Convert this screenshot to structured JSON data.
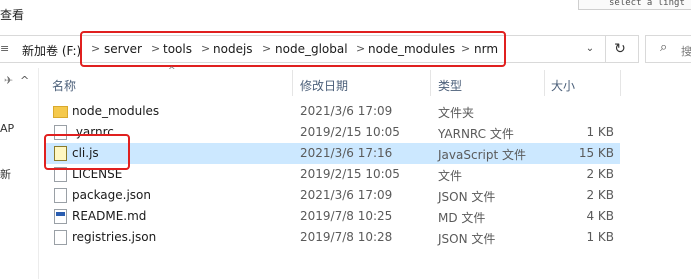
{
  "ribbon": {
    "tab_label": "查看",
    "tooltip_text": "select a lingt"
  },
  "address": {
    "drive_icon_char": "≡",
    "crumbs": [
      "新加卷 (F:)",
      "server",
      "tools",
      "nodejs",
      "node_global",
      "node_modules",
      "nrm"
    ],
    "separator": ">",
    "dropdown_char": "⌄",
    "refresh_char": "↻"
  },
  "search": {
    "icon_char": "⌕",
    "placeholder": "搜"
  },
  "nav_pane": {
    "pin_char": "✈",
    "collapse_char": "^",
    "items": [
      "AP",
      "新"
    ]
  },
  "columns": {
    "name": "名称",
    "date": "修改日期",
    "type": "类型",
    "size": "大小",
    "sort_char": "^"
  },
  "files": [
    {
      "name": "node_modules",
      "date": "2021/3/6 17:09",
      "type": "文件夹",
      "size": "",
      "icon": "folder-icon"
    },
    {
      "name": ".yarnrc",
      "date": "2019/2/15 10:05",
      "type": "YARNRC 文件",
      "size": "1 KB",
      "icon": "file-icon"
    },
    {
      "name": "cli.js",
      "date": "2021/3/6 17:16",
      "type": "JavaScript 文件",
      "size": "15 KB",
      "icon": "js-file-icon",
      "selected": true
    },
    {
      "name": "LICENSE",
      "date": "2019/2/15 10:05",
      "type": "文件",
      "size": "2 KB",
      "icon": "file-icon"
    },
    {
      "name": "package.json",
      "date": "2021/3/6 17:09",
      "type": "JSON 文件",
      "size": "2 KB",
      "icon": "json-file-icon"
    },
    {
      "name": "README.md",
      "date": "2019/7/8 10:25",
      "type": "MD 文件",
      "size": "4 KB",
      "icon": "md-file-icon"
    },
    {
      "name": "registries.json",
      "date": "2019/7/8 10:28",
      "type": "JSON 文件",
      "size": "1 KB",
      "icon": "json-file-icon"
    }
  ],
  "colors": {
    "selection": "#cce8ff",
    "highlight_box": "#e0201f",
    "header_text": "#4c607a"
  }
}
